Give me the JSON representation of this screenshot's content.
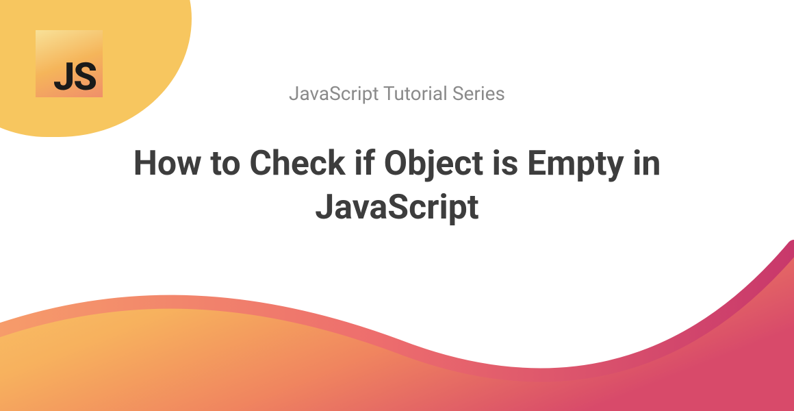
{
  "logo": {
    "text": "JS"
  },
  "subtitle": "JavaScript Tutorial Series",
  "title": "How to Check if Object is Empty in JavaScript"
}
